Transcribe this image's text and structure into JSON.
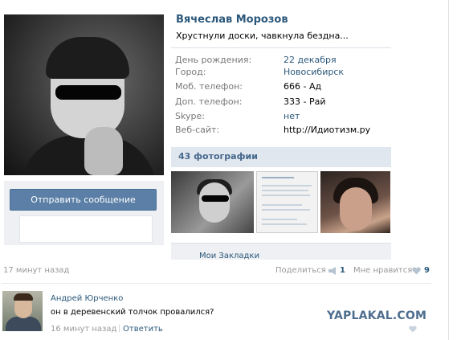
{
  "profile": {
    "name": "Вячеслав Морозов",
    "status": "Хрустнули доски, чавкнула бездна...",
    "send_message_label": "Отправить сообщение",
    "info": [
      {
        "label": "День рождения:",
        "value": "22 декабря",
        "is_link": true
      },
      {
        "label": "Город:",
        "value": "Новосибирск",
        "is_link": true
      },
      {
        "label": "Моб. телефон:",
        "value": "666 - Ад",
        "is_link": false
      },
      {
        "label": "Доп. телефон:",
        "value": "333 - Рай",
        "is_link": false
      },
      {
        "label": "Skype:",
        "value": "нет",
        "is_link": true
      },
      {
        "label": "Веб-сайт:",
        "value": "http://Идиотизм.ру",
        "is_link": false
      }
    ],
    "photos_header": "43 фотографии",
    "bookmarks_label": "Мои Закладки"
  },
  "post": {
    "time": "17 минут назад",
    "share_label": "Поделиться",
    "share_count": "1",
    "like_label": "Мне нравится",
    "like_count": "9"
  },
  "comment": {
    "author": "Андрей Юрченко",
    "text": "он в деревенский толчок провалился?",
    "time": "16 минут назад",
    "separator": "|",
    "reply_label": "Ответить"
  },
  "watermark": "YAPLAKAL.COM",
  "colors": {
    "link": "#2b587a",
    "button": "#5b7fa6",
    "muted": "#999999",
    "header_bg": "#e1e7ee",
    "watermark": "#4e6e8f"
  },
  "icons": {
    "share": "megaphone-icon",
    "like": "heart-icon",
    "comment_like": "heart-icon"
  }
}
